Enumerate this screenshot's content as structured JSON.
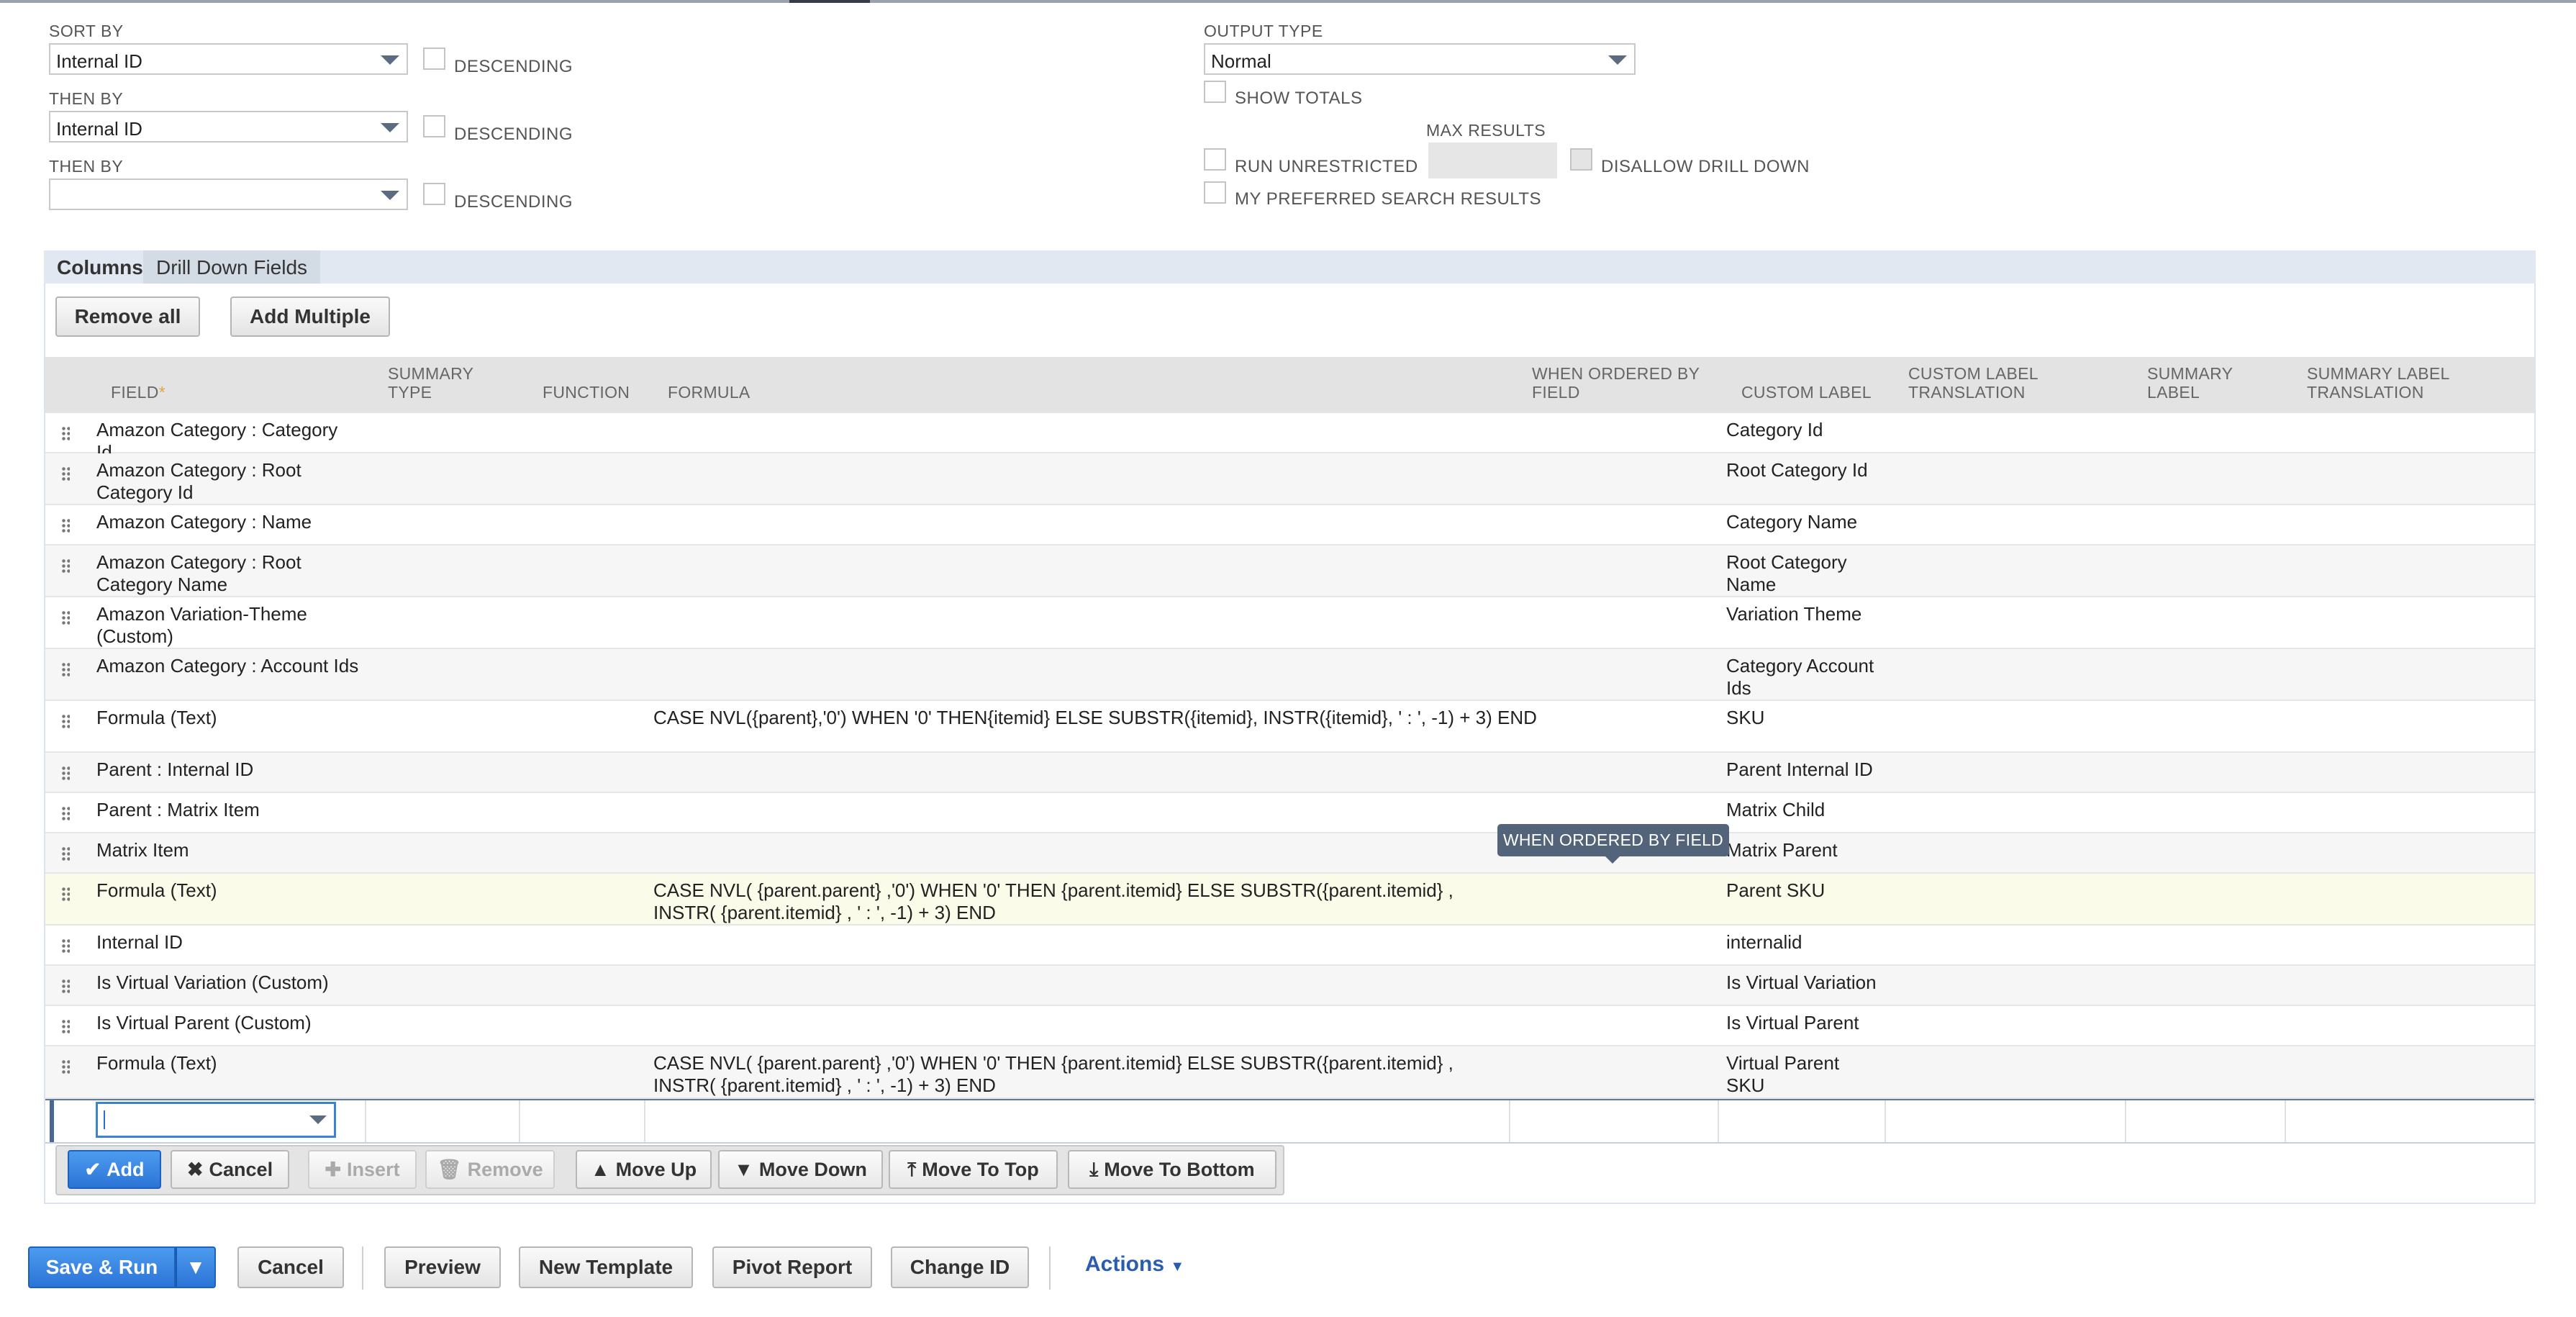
{
  "criteria": {
    "sort_by_label": "SORT BY",
    "sort_by_value": "Internal ID",
    "then_by_1_label": "THEN BY",
    "then_by_1_value": "Internal ID",
    "then_by_2_label": "THEN BY",
    "then_by_2_value": "",
    "descending_label": "DESCENDING",
    "output_type_label": "OUTPUT TYPE",
    "output_type_value": "Normal",
    "show_totals_label": "SHOW TOTALS",
    "max_results_label": "MAX RESULTS",
    "max_results_value": "",
    "run_unrestricted_label": "RUN UNRESTRICTED",
    "disallow_drill_down_label": "DISALLOW DRILL DOWN",
    "preferred_results_label": "MY PREFERRED SEARCH RESULTS"
  },
  "tabs": {
    "columns": "Columns •",
    "drill_down": "Drill Down Fields"
  },
  "toolbar": {
    "remove_all": "Remove all",
    "add_multiple": "Add Multiple"
  },
  "table": {
    "headers": {
      "field": "FIELD",
      "required_mark": "*",
      "summary_type_1": "SUMMARY",
      "summary_type_2": "TYPE",
      "function": "FUNCTION",
      "formula": "FORMULA",
      "when_ordered_1": "WHEN ORDERED BY",
      "when_ordered_2": "FIELD",
      "custom_label": "CUSTOM LABEL",
      "custom_label_translation_1": "CUSTOM LABEL",
      "custom_label_translation_2": "TRANSLATION",
      "summary_label_1": "SUMMARY",
      "summary_label_2": "LABEL",
      "summary_label_translation_1": "SUMMARY LABEL",
      "summary_label_translation_2": "TRANSLATION"
    },
    "rows": [
      {
        "field": "Amazon Category : Category Id",
        "formula": "",
        "label": "Category Id"
      },
      {
        "field": "Amazon Category : Root Category Id",
        "formula": "",
        "label": "Root Category Id"
      },
      {
        "field": "Amazon Category : Name",
        "formula": "",
        "label": "Category Name"
      },
      {
        "field": "Amazon Category : Root Category Name",
        "formula": "",
        "label": "Root Category Name"
      },
      {
        "field": "Amazon Variation-Theme (Custom)",
        "formula": "",
        "label": "Variation Theme"
      },
      {
        "field": "Amazon Category : Account Ids",
        "formula": "",
        "label": "Category Account Ids"
      },
      {
        "field": "Formula (Text)",
        "formula": "CASE NVL({parent},'0') WHEN '0' THEN{itemid} ELSE SUBSTR({itemid}, INSTR({itemid}, ' : ', -1) + 3) END",
        "label": "SKU"
      },
      {
        "field": "Parent : Internal ID",
        "formula": "",
        "label": "Parent Internal ID"
      },
      {
        "field": "Parent : Matrix Item",
        "formula": "",
        "label": "Matrix Child"
      },
      {
        "field": "Matrix Item",
        "formula": "",
        "label": "Matrix Parent"
      },
      {
        "field": "Formula (Text)",
        "formula": "CASE NVL( {parent.parent} ,'0') WHEN '0' THEN {parent.itemid} ELSE SUBSTR({parent.itemid} , INSTR( {parent.itemid} , ' : ', -1) + 3) END",
        "label": "Parent SKU"
      },
      {
        "field": "Internal ID",
        "formula": "",
        "label": "internalid"
      },
      {
        "field": "Is Virtual Variation (Custom)",
        "formula": "",
        "label": "Is Virtual Variation"
      },
      {
        "field": "Is Virtual Parent (Custom)",
        "formula": "",
        "label": "Is Virtual Parent"
      },
      {
        "field": "Formula (Text)",
        "formula": "CASE NVL( {parent.parent} ,'0') WHEN '0' THEN {parent.itemid} ELSE SUBSTR({parent.itemid} , INSTR( {parent.itemid} , ' : ', -1) + 3) END",
        "label": "Virtual Parent SKU"
      }
    ]
  },
  "tooltip": "WHEN ORDERED BY FIELD",
  "row_actions": {
    "add": "Add",
    "cancel": "Cancel",
    "insert": "Insert",
    "remove": "Remove",
    "move_up": "Move Up",
    "move_down": "Move Down",
    "move_to_top": "Move To Top",
    "move_to_bottom": "Move To Bottom"
  },
  "footer": {
    "save_run": "Save & Run",
    "cancel": "Cancel",
    "preview": "Preview",
    "new_template": "New Template",
    "pivot_report": "Pivot Report",
    "change_id": "Change ID",
    "actions": "Actions"
  },
  "colors": {
    "primary": "#2b74d6",
    "tab_bar": "#e1e8f1",
    "highlight_row": "#fbfbe9",
    "tooltip": "#52637a",
    "link": "#2a5db0"
  }
}
